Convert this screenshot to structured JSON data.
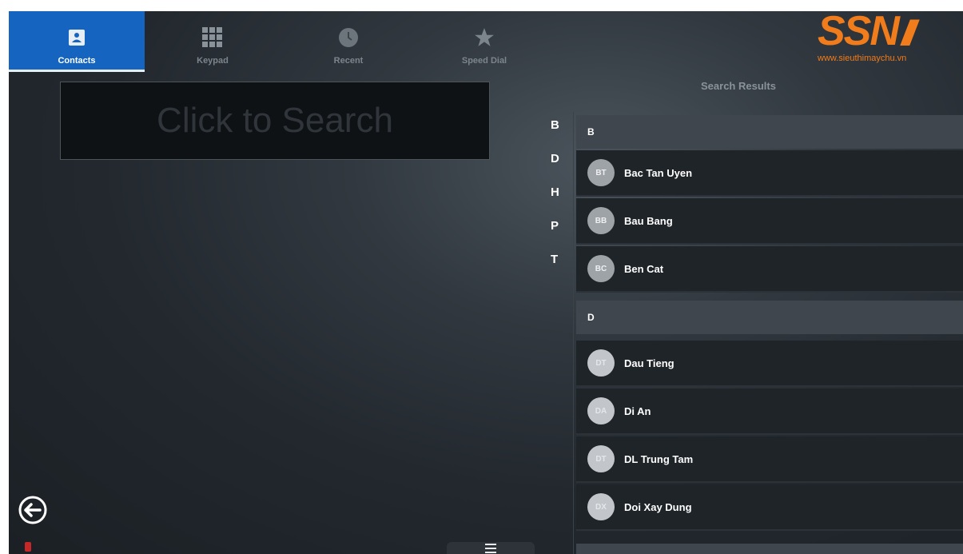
{
  "tabs": [
    {
      "label": "Contacts",
      "icon": "contacts-icon",
      "active": true
    },
    {
      "label": "Keypad",
      "icon": "keypad-grid-icon",
      "active": false
    },
    {
      "label": "Recent",
      "icon": "clock-icon",
      "active": false
    },
    {
      "label": "Speed Dial",
      "icon": "star-icon",
      "active": false
    }
  ],
  "logo": {
    "mark": "SSN",
    "url": "www.sieuthimaychu.vn"
  },
  "search": {
    "placeholder": "Click to Search"
  },
  "results_title": "Search Results",
  "index_letters": [
    "B",
    "D",
    "H",
    "P",
    "T"
  ],
  "sections": [
    {
      "letter": "B",
      "contacts": [
        {
          "initials": "BT",
          "name": "Bac Tan Uyen"
        },
        {
          "initials": "BB",
          "name": "Bau Bang"
        },
        {
          "initials": "BC",
          "name": "Ben Cat"
        }
      ]
    },
    {
      "letter": "D",
      "contacts": [
        {
          "initials": "DT",
          "name": "Dau Tieng"
        },
        {
          "initials": "DA",
          "name": "Di An"
        },
        {
          "initials": "DT",
          "name": "DL Trung Tam"
        },
        {
          "initials": "DX",
          "name": "Doi Xay Dung"
        }
      ]
    }
  ],
  "colors": {
    "accent": "#1565c0",
    "logo": "#f07c1c"
  }
}
